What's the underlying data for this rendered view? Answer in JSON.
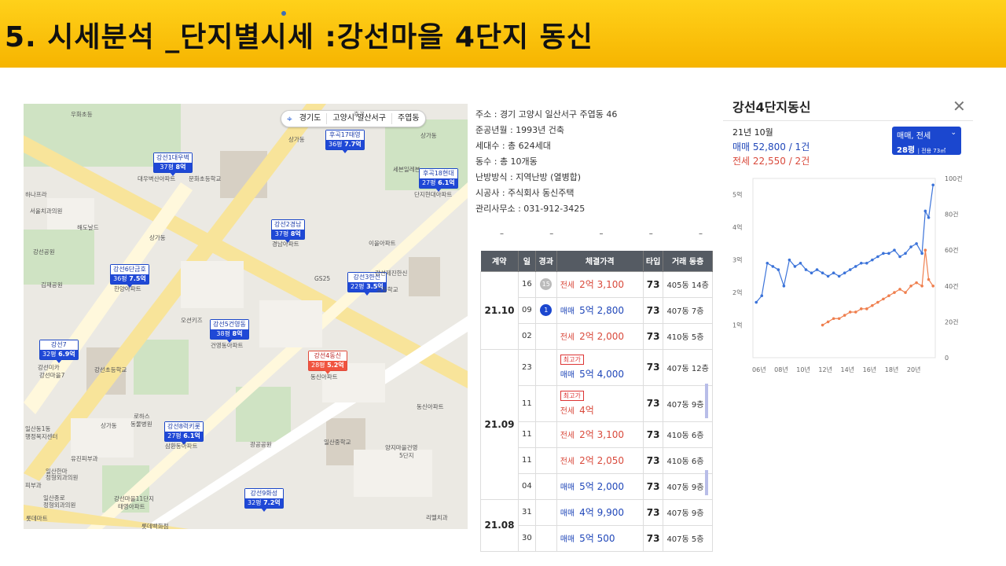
{
  "slide": {
    "title": "5. 시세분석 _단지별시세 :강선마을 4단지 동신"
  },
  "map": {
    "locbar": [
      "경기도",
      "고양시 일산서구",
      "주엽동"
    ],
    "markers": [
      {
        "name": "후곡17태영",
        "area": "36평",
        "price": "7.7억"
      },
      {
        "name": "강선1대우벽",
        "area": "37평",
        "price": "8억"
      },
      {
        "name": "후곡18현대",
        "area": "27평",
        "price": "6.1억"
      },
      {
        "name": "강선2경남",
        "area": "37평",
        "price": "8억"
      },
      {
        "name": "강선6단금호",
        "area": "36평",
        "price": "7.5억"
      },
      {
        "name": "강선3한신",
        "area": "22평",
        "price": "3.5억"
      },
      {
        "name": "강선5건영동",
        "area": "38평",
        "price": "8억"
      },
      {
        "name": "강선7",
        "area": "32평",
        "price": "6.9억"
      },
      {
        "name": "강선4동신",
        "area": "28평",
        "price": "5.2억"
      },
      {
        "name": "강선8럭키롯",
        "area": "27평",
        "price": "6.1억"
      },
      {
        "name": "강선9화성",
        "area": "32평",
        "price": "7.2억"
      }
    ],
    "labels": [
      "우화초등",
      "후곡",
      "상가동",
      "상가동",
      "하나프라",
      "서울치과의원",
      "해도날드",
      "상가동",
      "강선공원",
      "대우벽산아파트",
      "문화초등학교",
      "세븐일레븐",
      "단지현대아파트",
      "이을아파트",
      "경남아파트",
      "GS25",
      "강선제진한신",
      "고등학교",
      "김재공원",
      "한양아파트",
      "오션키즈",
      "건영동아파트",
      "동신아파트",
      "강선미카",
      "강선초등학교",
      "강선마을7",
      "삼환동아파트",
      "로하스",
      "동물병원",
      "상가동",
      "일산동1동",
      "행정복지센터",
      "유진피부과",
      "일산한마",
      "정형외과의원",
      "피부과",
      "일산종로",
      "정형외과의원",
      "롯데마트",
      "롯데백화점",
      "강선마을11단지",
      "태영아파트",
      "양지마을건영",
      "5단지",
      "리멜치과",
      "일산중학교",
      "광공공원",
      "동신아파트"
    ]
  },
  "info": {
    "lines": [
      "주소 : 경기 고양시 일산서구 주엽동 46",
      "준공년월 : 1993년 건축",
      "세대수 : 총 624세대",
      "동수 : 총 10개동",
      "난방방식 : 지역난방 (열병합)",
      "시공사 : 주식회사 동신주택",
      "관리사무소 : 031-912-3425"
    ]
  },
  "dashes": [
    "–",
    "–",
    "–",
    "–",
    "–"
  ],
  "table": {
    "headers": [
      "계약",
      "일",
      "경과",
      "체결가격",
      "타입",
      "거래 동층"
    ],
    "groups": [
      {
        "month": "21.10",
        "rows": [
          {
            "day": "16",
            "count": "15",
            "count_style": "gray",
            "kind": "전세",
            "price": "2억 3,100",
            "type": "73",
            "floor": "405동 14층"
          },
          {
            "day": "09",
            "count": "1",
            "count_style": "blue",
            "kind": "매매",
            "price": "5억 2,800",
            "type": "73",
            "floor": "407동 7층"
          },
          {
            "day": "02",
            "count": "",
            "kind": "전세",
            "price": "2억 2,000",
            "type": "73",
            "floor": "410동 5층"
          }
        ]
      },
      {
        "month": "21.09",
        "rows": [
          {
            "day": "23",
            "count": "",
            "badge": "최고가",
            "kind": "매매",
            "price": "5억 4,000",
            "type": "73",
            "floor": "407동 12층"
          },
          {
            "day": "11",
            "count": "",
            "badge": "최고가",
            "kind": "전세",
            "price": "4억",
            "type": "73",
            "floor": "407동 9층"
          },
          {
            "day": "11",
            "count": "",
            "kind": "전세",
            "price": "2억 3,100",
            "type": "73",
            "floor": "410동 6층"
          },
          {
            "day": "11",
            "count": "",
            "kind": "전세",
            "price": "2억 2,050",
            "type": "73",
            "floor": "410동 6층"
          },
          {
            "day": "04",
            "count": "",
            "kind": "매매",
            "price": "5억 2,000",
            "type": "73",
            "floor": "407동 9층"
          }
        ]
      },
      {
        "month": "21.08",
        "rows": [
          {
            "day": "31",
            "count": "",
            "kind": "매매",
            "price": "4억 9,900",
            "type": "73",
            "floor": "407동 9층"
          },
          {
            "day": "30",
            "count": "",
            "kind": "매매",
            "price": "5억 500",
            "type": "73",
            "floor": "407동 5층"
          }
        ]
      }
    ]
  },
  "panel": {
    "title": "강선4단지동신",
    "month": "21년 10월",
    "sale": "매매 52,800 / 1건",
    "rent": "전세 22,550 / 2건",
    "selector_line1": "매매, 전세",
    "selector_pyeong": "28평",
    "selector_area": "| 전용 73㎡"
  },
  "chart_data": {
    "type": "line",
    "title": "",
    "x_ticks": [
      "06년",
      "08년",
      "10년",
      "12년",
      "14년",
      "16년",
      "18년",
      "20년"
    ],
    "y_left_ticks": [
      "1억",
      "2억",
      "3억",
      "4억",
      "5억"
    ],
    "y_right_ticks": [
      "0",
      "20건",
      "40건",
      "60건",
      "80건",
      "100건"
    ],
    "y_left_range": [
      0,
      5.5
    ],
    "y_right_range": [
      0,
      100
    ],
    "series": [
      {
        "name": "매매",
        "color": "#3b73d9",
        "x": [
          2005.8,
          2006.3,
          2006.8,
          2007.3,
          2007.8,
          2008.3,
          2008.8,
          2009.3,
          2009.8,
          2010.3,
          2010.8,
          2011.3,
          2011.8,
          2012.3,
          2012.8,
          2013.3,
          2013.8,
          2014.3,
          2014.8,
          2015.3,
          2015.8,
          2016.3,
          2016.8,
          2017.3,
          2017.8,
          2018.3,
          2018.8,
          2019.3,
          2019.8,
          2020.3,
          2020.8,
          2021.1,
          2021.4,
          2021.8
        ],
        "y": [
          1.7,
          1.9,
          2.9,
          2.8,
          2.7,
          2.2,
          3.0,
          2.8,
          2.9,
          2.7,
          2.6,
          2.7,
          2.6,
          2.5,
          2.6,
          2.5,
          2.6,
          2.7,
          2.8,
          2.9,
          2.9,
          3.0,
          3.1,
          3.2,
          3.2,
          3.3,
          3.1,
          3.2,
          3.4,
          3.5,
          3.2,
          4.5,
          4.3,
          5.3
        ]
      },
      {
        "name": "전세",
        "color": "#ef7f4e",
        "x": [
          2011.8,
          2012.3,
          2012.8,
          2013.3,
          2013.8,
          2014.3,
          2014.8,
          2015.3,
          2015.8,
          2016.3,
          2016.8,
          2017.3,
          2017.8,
          2018.3,
          2018.8,
          2019.3,
          2019.8,
          2020.3,
          2020.8,
          2021.1,
          2021.4,
          2021.8
        ],
        "y": [
          1.0,
          1.1,
          1.2,
          1.2,
          1.3,
          1.4,
          1.4,
          1.5,
          1.5,
          1.6,
          1.7,
          1.8,
          1.9,
          2.0,
          2.1,
          2.0,
          2.2,
          2.3,
          2.2,
          3.3,
          2.4,
          2.2
        ]
      }
    ],
    "grid": false,
    "legend": "none"
  }
}
